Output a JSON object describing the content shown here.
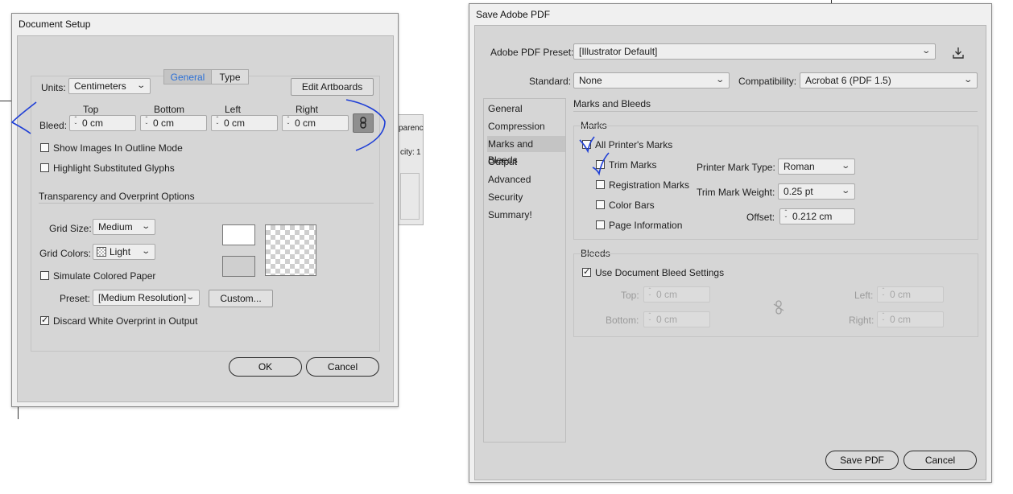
{
  "doc_setup": {
    "title": "Document Setup",
    "tabs": [
      "General",
      "Type"
    ],
    "units_label": "Units:",
    "units_value": "Centimeters",
    "edit_artboards": "Edit Artboards",
    "bleed_label": "Bleed:",
    "bleed_cols": [
      "Top",
      "Bottom",
      "Left",
      "Right"
    ],
    "bleed_values": [
      "0 cm",
      "0 cm",
      "0 cm",
      "0 cm"
    ],
    "show_images_outline": "Show Images In Outline Mode",
    "highlight_glyphs": "Highlight Substituted Glyphs",
    "transparency_heading": "Transparency and Overprint Options",
    "grid_size_label": "Grid Size:",
    "grid_size_value": "Medium",
    "grid_colors_label": "Grid Colors:",
    "grid_colors_value": "Light",
    "simulate_paper": "Simulate Colored Paper",
    "preset_label": "Preset:",
    "preset_value": "[Medium Resolution]",
    "custom_button": "Custom...",
    "discard_white": "Discard White Overprint in Output",
    "ok": "OK",
    "cancel": "Cancel"
  },
  "background_panel": {
    "text1": "parenc",
    "text2": "city:",
    "text3": "1"
  },
  "save_pdf": {
    "title": "Save Adobe PDF",
    "preset_label": "Adobe PDF Preset:",
    "preset_value": "[Illustrator Default]",
    "standard_label": "Standard:",
    "standard_value": "None",
    "compat_label": "Compatibility:",
    "compat_value": "Acrobat 6 (PDF 1.5)",
    "nav": [
      "General",
      "Compression",
      "Marks and Bleeds",
      "Output",
      "Advanced",
      "Security",
      "Summary!"
    ],
    "section_title": "Marks and Bleeds",
    "marks_heading": "Marks",
    "all_marks": "All Printer's Marks",
    "trim_marks": "Trim Marks",
    "registration_marks": "Registration Marks",
    "color_bars": "Color Bars",
    "page_information": "Page Information",
    "mark_type_label": "Printer Mark Type:",
    "mark_type_value": "Roman",
    "trim_weight_label": "Trim Mark Weight:",
    "trim_weight_value": "0.25 pt",
    "offset_label": "Offset:",
    "offset_value": "0.212 cm",
    "bleeds_heading": "Bleeds",
    "use_doc_bleed": "Use Document Bleed Settings",
    "top_label": "Top:",
    "bottom_label": "Bottom:",
    "left_label": "Left:",
    "right_label": "Right:",
    "top_value": "0 cm",
    "bottom_value": "0 cm",
    "left_value": "0 cm",
    "right_value": "0 cm",
    "save_button": "Save PDF",
    "cancel_button": "Cancel"
  },
  "colors": {
    "accent_tab": "#2a6fd6",
    "annotation_ink": "#1f3fd6"
  }
}
